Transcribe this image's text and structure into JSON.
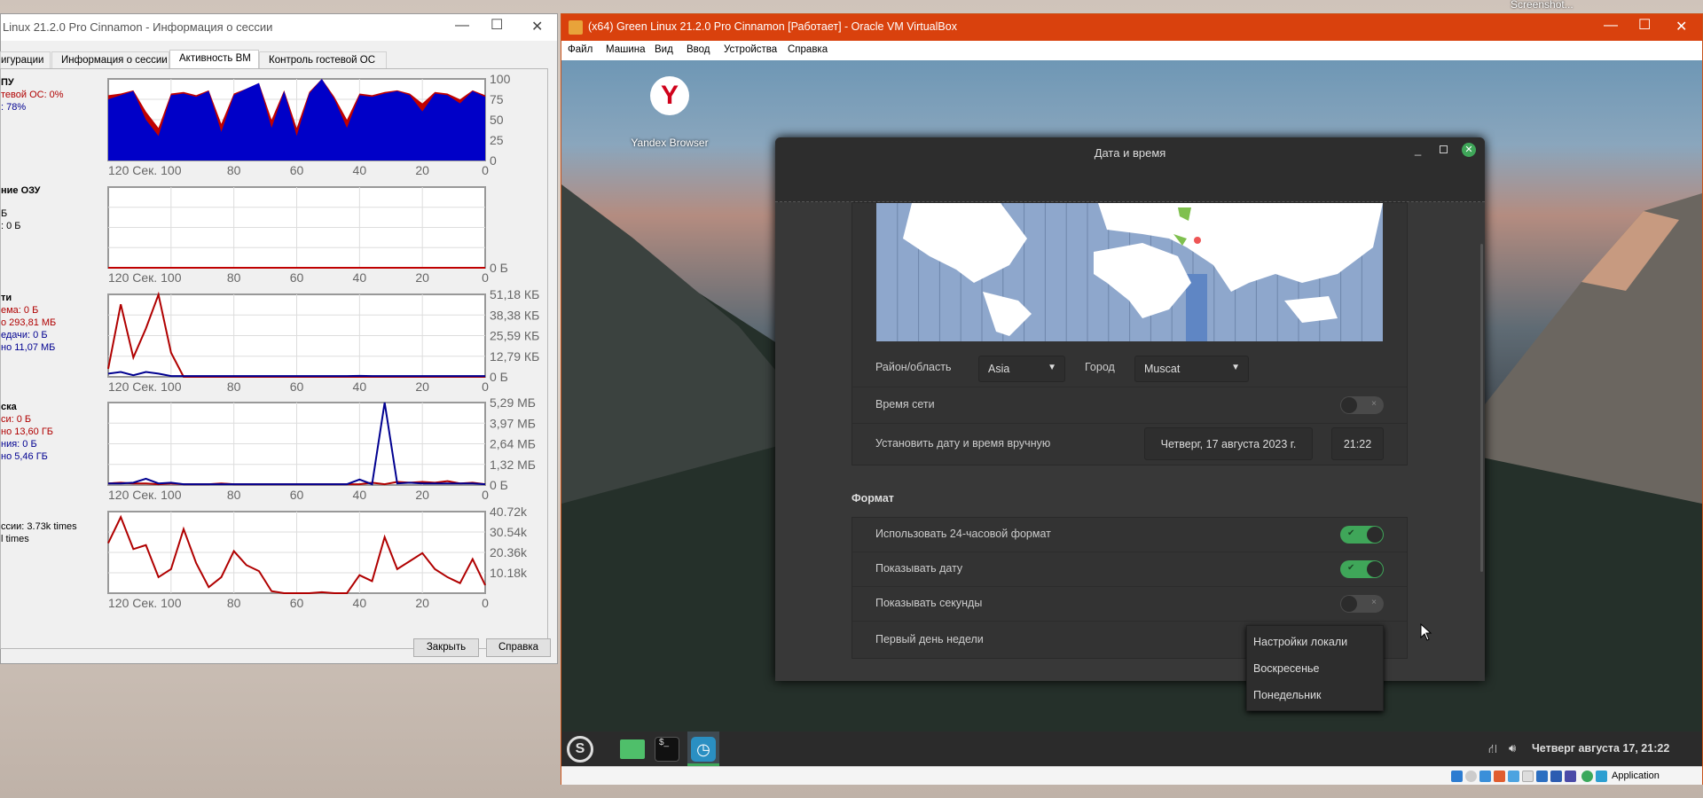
{
  "desktop": {
    "screenshot_label": "Screenshot..."
  },
  "session_window": {
    "title": "Linux 21.2.0 Pro Cinnamon - Информация о сессии",
    "tabs": [
      {
        "label": "игурации"
      },
      {
        "label": "Информация о сессии"
      },
      {
        "label": "Активность ВМ",
        "selected": true
      },
      {
        "label": "Контроль гостевой ОС"
      }
    ],
    "sections": {
      "cpu": {
        "heading": "ПУ",
        "lines": [
          "тевой ОС: 0%",
          ": 78%"
        ]
      },
      "ram": {
        "heading": "ние ОЗУ",
        "lines": [
          "Б",
          ": 0 Б"
        ]
      },
      "net": {
        "heading": "ти",
        "lines": [
          "ема: 0 Б",
          "о 293,81 МБ",
          "едачи: 0 Б",
          "но 11,07 МБ"
        ]
      },
      "disk": {
        "heading": "ска",
        "lines": [
          "си: 0 Б",
          "но 13,60 ГБ",
          "ния: 0 Б",
          "но 5,46 ГБ"
        ]
      },
      "vmexits": {
        "lines": [
          "ссии: 3.73k times",
          "l times"
        ]
      }
    },
    "buttons": {
      "close": "Закрыть",
      "help": "Справка"
    }
  },
  "chart_data": [
    {
      "type": "area",
      "x_label": "120 Сек.",
      "xlim": [
        120,
        0
      ],
      "x_ticks": [
        "100",
        "80",
        "60",
        "40",
        "20",
        "0"
      ],
      "y_ticks": [
        "100",
        "75",
        "50",
        "25",
        "0"
      ],
      "ylim": [
        0,
        100
      ],
      "grid": true,
      "x": [
        120,
        116,
        112,
        108,
        104,
        100,
        96,
        92,
        88,
        84,
        80,
        76,
        72,
        68,
        64,
        60,
        56,
        52,
        48,
        44,
        40,
        36,
        32,
        28,
        24,
        20,
        16,
        12,
        8,
        4,
        0
      ],
      "series": [
        {
          "color": "#c00000",
          "values": [
            80,
            82,
            86,
            60,
            40,
            82,
            84,
            80,
            86,
            45,
            82,
            88,
            95,
            50,
            86,
            40,
            84,
            100,
            78,
            50,
            82,
            80,
            84,
            86,
            82,
            70,
            84,
            82,
            75,
            86,
            80
          ]
        },
        {
          "color": "#0000c8",
          "values": [
            75,
            80,
            85,
            50,
            30,
            80,
            82,
            78,
            85,
            35,
            80,
            88,
            95,
            40,
            85,
            30,
            82,
            100,
            75,
            40,
            80,
            78,
            82,
            85,
            80,
            60,
            82,
            80,
            70,
            85,
            78
          ]
        }
      ]
    },
    {
      "type": "line",
      "x_label": "120 Сек.",
      "xlim": [
        120,
        0
      ],
      "x_ticks": [
        "100",
        "80",
        "60",
        "40",
        "20",
        "0"
      ],
      "y_ticks": [
        "0 Б"
      ],
      "ylim": [
        0,
        1
      ],
      "grid": true,
      "x": [
        120,
        0
      ],
      "series": [
        {
          "color": "#c00000",
          "values": [
            0,
            0
          ]
        }
      ]
    },
    {
      "type": "line",
      "x_label": "120 Сек.",
      "xlim": [
        120,
        0
      ],
      "x_ticks": [
        "100",
        "80",
        "60",
        "40",
        "20",
        "0"
      ],
      "y_ticks": [
        "51,18 КБ",
        "38,38 КБ",
        "25,59 КБ",
        "12,79 КБ",
        "0 Б"
      ],
      "ylim": [
        0,
        51.18
      ],
      "grid": true,
      "x": [
        120,
        116,
        112,
        108,
        104,
        100,
        96,
        92,
        88,
        84,
        80,
        76,
        72,
        68,
        64,
        60,
        56,
        52,
        48,
        44,
        40,
        36,
        32,
        28,
        24,
        20,
        16,
        12,
        8,
        4,
        0
      ],
      "series": [
        {
          "color": "#b00000",
          "values": [
            5,
            45,
            12,
            30,
            51,
            15,
            0,
            0,
            0,
            0,
            0,
            0,
            0,
            0,
            0,
            0,
            0,
            0,
            0,
            0,
            0,
            0,
            0,
            0,
            0,
            0,
            0,
            0,
            0,
            0,
            0
          ]
        },
        {
          "color": "#000090",
          "values": [
            2,
            3,
            1,
            3,
            2,
            0.5,
            0.5,
            0.5,
            0.5,
            0.5,
            0.5,
            0.5,
            0.5,
            0.5,
            0.5,
            0.5,
            0.5,
            0.5,
            0.5,
            0.5,
            0.6,
            0.5,
            0.5,
            0.5,
            0.5,
            0.5,
            0.5,
            0.5,
            0.5,
            0.5,
            0.5
          ]
        }
      ]
    },
    {
      "type": "line",
      "x_label": "120 Сек.",
      "xlim": [
        120,
        0
      ],
      "x_ticks": [
        "100",
        "80",
        "60",
        "40",
        "20",
        "0"
      ],
      "y_ticks": [
        "5,29 МБ",
        "3,97 МБ",
        "2,64 МБ",
        "1,32 МБ",
        "0 Б"
      ],
      "ylim": [
        0,
        5.29
      ],
      "grid": true,
      "x": [
        120,
        116,
        112,
        108,
        104,
        100,
        96,
        92,
        88,
        84,
        80,
        76,
        72,
        68,
        64,
        60,
        56,
        52,
        48,
        44,
        40,
        36,
        32,
        28,
        24,
        20,
        16,
        12,
        8,
        4,
        0
      ],
      "series": [
        {
          "color": "#b00000",
          "values": [
            0.1,
            0.15,
            0.1,
            0.1,
            0.05,
            0.1,
            0.05,
            0.05,
            0.05,
            0.1,
            0.05,
            0.05,
            0.05,
            0.05,
            0.05,
            0.05,
            0.05,
            0.05,
            0.05,
            0.05,
            0.05,
            0.15,
            0.05,
            0.2,
            0.15,
            0.2,
            0.15,
            0.25,
            0.1,
            0.15,
            0.05
          ]
        },
        {
          "color": "#000090",
          "values": [
            0.1,
            0.1,
            0.15,
            0.4,
            0.1,
            0.15,
            0.05,
            0.05,
            0.05,
            0.05,
            0.05,
            0.05,
            0.05,
            0.05,
            0.05,
            0.05,
            0.05,
            0.05,
            0.05,
            0.05,
            0.35,
            0.05,
            5.29,
            0.1,
            0.15,
            0.1,
            0.1,
            0.1,
            0.1,
            0.1,
            0.05
          ]
        }
      ]
    },
    {
      "type": "line",
      "x_label": "120 Сек.",
      "xlim": [
        120,
        0
      ],
      "x_ticks": [
        "100",
        "80",
        "60",
        "40",
        "20",
        "0"
      ],
      "y_ticks": [
        "40.72k",
        "30.54k",
        "20.36k",
        "10.18k"
      ],
      "ylim": [
        0,
        40.72
      ],
      "grid": true,
      "x": [
        120,
        116,
        112,
        108,
        104,
        100,
        96,
        92,
        88,
        84,
        80,
        76,
        72,
        68,
        64,
        60,
        56,
        52,
        48,
        44,
        40,
        36,
        32,
        28,
        24,
        20,
        16,
        12,
        8,
        4,
        0
      ],
      "series": [
        {
          "color": "#b00000",
          "values": [
            25,
            38,
            22,
            24,
            8,
            12,
            32,
            15,
            3,
            8,
            21,
            14,
            11,
            1,
            0,
            0,
            0,
            0.5,
            0,
            0,
            9,
            6,
            28,
            12,
            16,
            20,
            12,
            8,
            5,
            17,
            4
          ]
        }
      ]
    }
  ],
  "vbox": {
    "title": "(x64) Green Linux 21.2.0 Pro Cinnamon [Работает] - Oracle VM VirtualBox",
    "accent": "#d9410d",
    "menu": [
      "Файл",
      "Машина",
      "Вид",
      "Ввод",
      "Устройства",
      "Справка"
    ],
    "status_text": "Application"
  },
  "guest": {
    "desktop_icon": "Yandex Browser",
    "dialog": {
      "title": "Дата и время",
      "region_label": "Район/область",
      "region_value": "Asia",
      "city_label": "Город",
      "city_value": "Muscat",
      "network_time_label": "Время сети",
      "network_time_on": false,
      "manual_label": "Установить дату и время вручную",
      "date_value": "Четверг, 17 августа 2023 г.",
      "time_value": "21:22",
      "format_heading": "Формат",
      "format_rows": [
        {
          "label": "Использовать 24-часовой формат",
          "on": true
        },
        {
          "label": "Показывать дату",
          "on": true
        },
        {
          "label": "Показывать секунды",
          "on": false
        },
        {
          "label": "Первый день недели"
        }
      ],
      "popup_options": [
        "Настройки локали",
        "Воскресенье",
        "Понедельник"
      ]
    },
    "taskbar": {
      "clock": "Четверг августа 17, 21:22"
    }
  }
}
